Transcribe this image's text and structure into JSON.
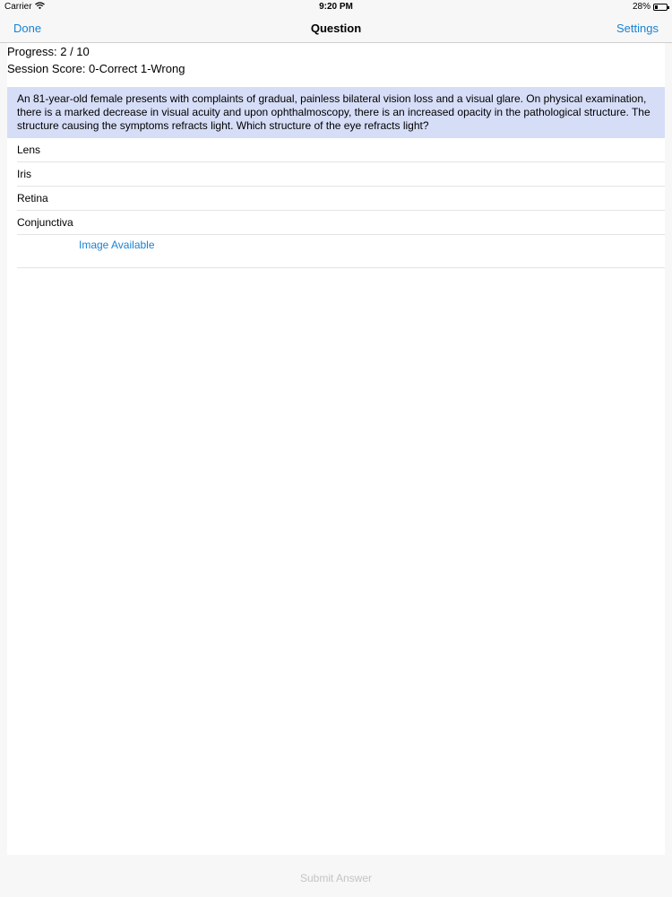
{
  "status": {
    "carrier": "Carrier",
    "time": "9:20 PM",
    "battery": "28%",
    "battery_level": 0.28
  },
  "nav": {
    "done_label": "Done",
    "title": "Question",
    "settings_label": "Settings"
  },
  "info": {
    "progress": "Progress: 2 / 10",
    "score": "Session Score: 0-Correct 1-Wrong"
  },
  "question": {
    "text": "An 81-year-old female presents with complaints of gradual, painless bilateral vision loss and a visual glare. On physical examination, there is a marked decrease in visual acuity and upon ophthalmoscopy, there is an increased opacity in the pathological structure. The structure causing the symptoms refracts light. Which structure of the eye refracts light?"
  },
  "answers": [
    "Lens",
    "Iris",
    "Retina",
    "Conjunctiva"
  ],
  "image_label": "Image Available",
  "submit_label": "Submit Answer",
  "colors": {
    "accent": "#1a82d2",
    "question_bg": "#d6ddf7",
    "disabled": "#c4c4c4"
  }
}
